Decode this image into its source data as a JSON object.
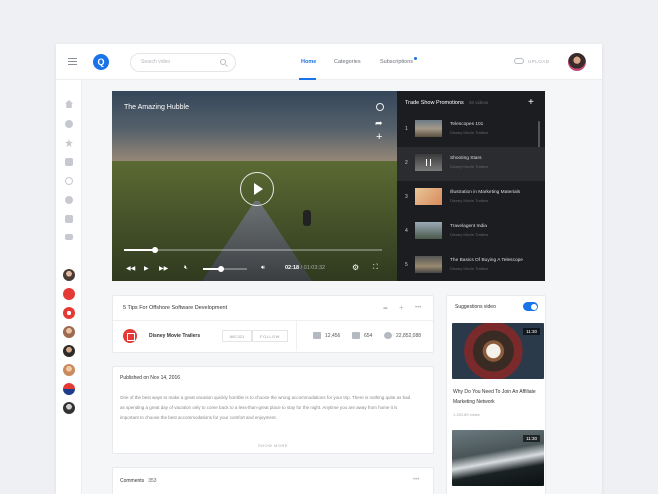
{
  "header": {
    "logo_letter": "Q",
    "search_placeholder": "Search video",
    "nav": [
      {
        "label": "Home",
        "active": true
      },
      {
        "label": "Categories",
        "active": false
      },
      {
        "label": "Subscriptions",
        "active": false,
        "notify": true
      }
    ],
    "upload_label": "UPLOAD"
  },
  "sidebar": {
    "icons": [
      "home-icon",
      "user-icon",
      "star-icon",
      "inbox-icon",
      "history-icon",
      "clock-icon",
      "like-icon",
      "playlist-icon"
    ],
    "channels": [
      "channel-avatar-1",
      "channel-avatar-2",
      "channel-avatar-3",
      "channel-avatar-4",
      "channel-avatar-5",
      "channel-avatar-6",
      "channel-avatar-7",
      "channel-avatar-8"
    ]
  },
  "player": {
    "title": "The Amazing Hubble",
    "progress": 0.12,
    "volume": 0.4,
    "current_time": "02:18",
    "total_time": "/ 01:03:32"
  },
  "playlist": {
    "title": "Trade Show Promotions",
    "count": "20 videos",
    "items": [
      {
        "num": "1",
        "title": "Telescopes 101",
        "channel": "Disney Movie Trailers",
        "selected": false
      },
      {
        "num": "2",
        "title": "Shooting Stars",
        "channel": "Disney Movie Trailers",
        "selected": true
      },
      {
        "num": "3",
        "title": "Illustration in Marketing Materials",
        "channel": "Disney Movie Trailers",
        "selected": false
      },
      {
        "num": "4",
        "title": "Travelagent India",
        "channel": "Disney Movie Trailers",
        "selected": false
      },
      {
        "num": "5",
        "title": "The Basics Of Buying A Telescope",
        "channel": "Disney Movie Trailers",
        "selected": false
      }
    ]
  },
  "video_info": {
    "title": "5 Tips For Offshore Software Development",
    "channel": "Disney Movie Trailers",
    "subscribers": "892,321",
    "follow_label": "FOLLOW",
    "likes": "12,456",
    "dislikes": "654",
    "views": "22,852,088"
  },
  "description": {
    "published": "Published on Nov 14, 2016",
    "text": "One of the best ways to make a great vacation quickly horrible is to choose the wrong accommodations for your trip. There is nothing quite as bad as spending a great day of vacation only to come back to a less-than-great place to stay for the night. Anytime you are away from home it is important to choose the best accommodations for your comfort and enjoyment.",
    "show_more": "SHOW MORE"
  },
  "comments": {
    "label": "Comments",
    "count": "353"
  },
  "suggestions": {
    "label": "Suggestions video",
    "toggle_on": true,
    "items": [
      {
        "duration": "11:30",
        "title": "Why Do You Need To Join An Affiliate Marketing Network",
        "views": "1,253,89 views"
      },
      {
        "duration": "11:30"
      }
    ]
  },
  "colors": {
    "accent": "#1a73e8",
    "player_bg": "#1c1d20"
  }
}
